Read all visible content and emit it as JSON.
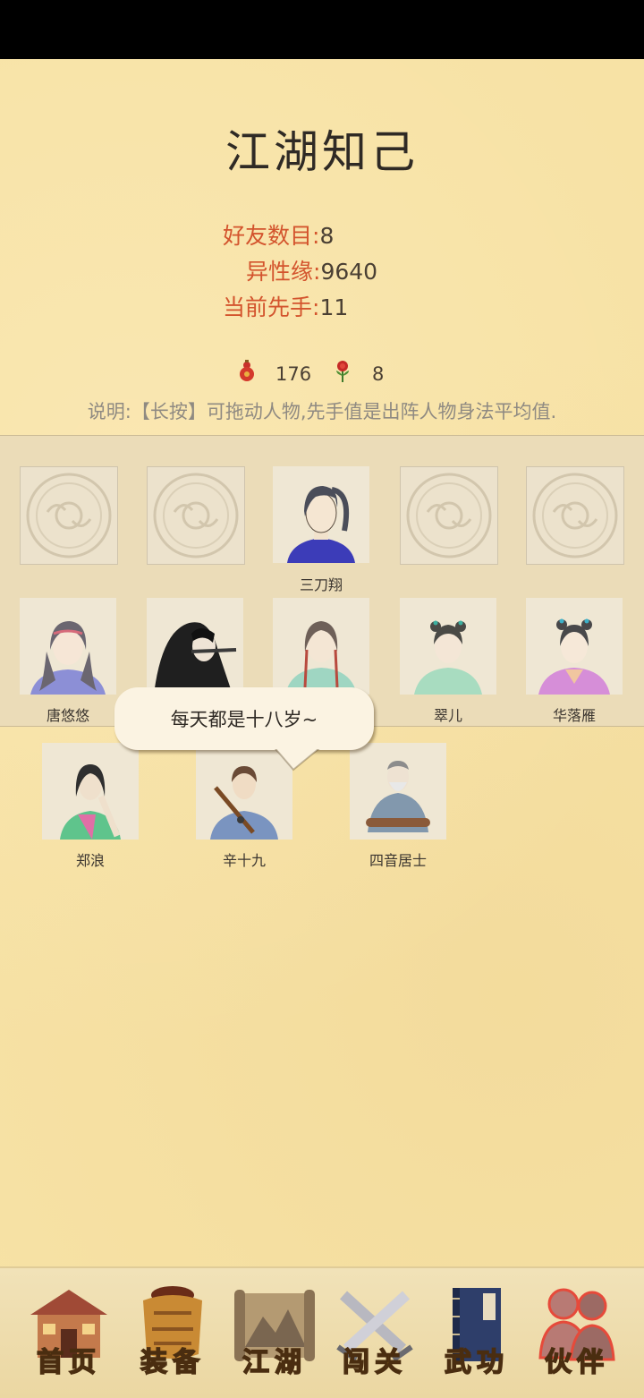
{
  "page": {
    "title": "江湖知己"
  },
  "stats": [
    {
      "label": "好友数目",
      "value": "8"
    },
    {
      "label": "异性缘",
      "value": "9640"
    },
    {
      "label": "当前先手",
      "value": "11"
    }
  ],
  "resources": {
    "gourd_count": "176",
    "flower_count": "8"
  },
  "note": "说明:【长按】可拖动人物,先手值是出阵人物身法平均值.",
  "formation": [
    {
      "name": ""
    },
    {
      "name": ""
    },
    {
      "name": "三刀翔"
    },
    {
      "name": ""
    },
    {
      "name": ""
    }
  ],
  "row2": [
    {
      "name": "唐悠悠"
    },
    {
      "name": ""
    },
    {
      "name": ""
    },
    {
      "name": "翠儿"
    },
    {
      "name": "华落雁"
    }
  ],
  "others": [
    {
      "name": "郑浪"
    },
    {
      "name": "辛十九"
    },
    {
      "name": "四音居士"
    }
  ],
  "bubble": {
    "text": "每天都是十八岁~"
  },
  "nav": [
    {
      "label": "首页",
      "icon": "house-icon"
    },
    {
      "label": "装备",
      "icon": "armor-icon"
    },
    {
      "label": "江湖",
      "icon": "scroll-map-icon"
    },
    {
      "label": "闯关",
      "icon": "crossed-swords-icon"
    },
    {
      "label": "武功",
      "icon": "book-icon"
    },
    {
      "label": "伙伴",
      "icon": "companions-icon"
    }
  ],
  "colors": {
    "background": "#f7e2a5",
    "stat_label": "#d3542d",
    "nav_label": "#e0b02a"
  }
}
